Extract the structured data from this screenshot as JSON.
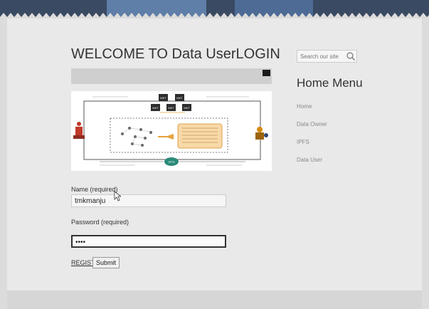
{
  "page": {
    "title": "WELCOME TO Data UserLOGIN"
  },
  "diagram": {
    "nodes": [
      "MKT",
      "MKT",
      "MKT",
      "MKT",
      "MKT"
    ],
    "center_label": "IPFS"
  },
  "form": {
    "name_label": "Name (required)",
    "name_value": "tmkmanju",
    "password_label": "Password (required)",
    "password_value": "••••",
    "register_label": "REGISTER",
    "submit_label": "Submit"
  },
  "sidebar": {
    "search_placeholder": "Search our site",
    "heading": "Home  Menu",
    "items": [
      {
        "label": "Home"
      },
      {
        "label": "Data Owner"
      },
      {
        "label": "IPFS"
      },
      {
        "label": "Data User"
      }
    ]
  },
  "colors": {
    "banner": "#3a4a63",
    "page_bg": "#e9e9e9",
    "sidebar_link": "#888888"
  }
}
